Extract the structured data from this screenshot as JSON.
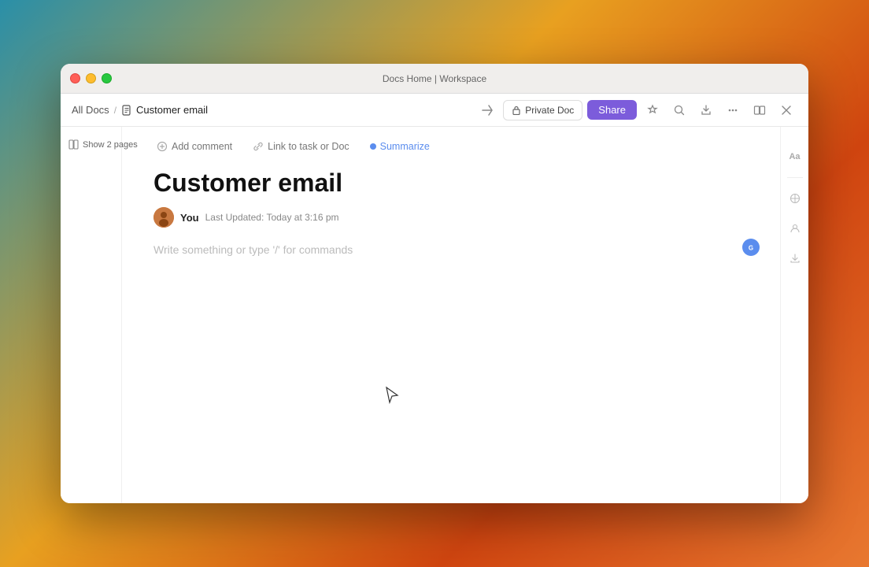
{
  "window": {
    "title": "Docs Home | Workspace"
  },
  "breadcrumb": {
    "all_docs_label": "All Docs",
    "separator": "/",
    "current_doc": "Customer email"
  },
  "toolbar": {
    "private_doc_label": "Private Doc",
    "share_label": "Share"
  },
  "sidebar_left": {
    "show_pages_label": "Show 2 pages"
  },
  "doc_actions": {
    "add_comment_label": "Add comment",
    "link_task_label": "Link to task or Doc",
    "summarize_label": "Summarize"
  },
  "document": {
    "title": "Customer email",
    "author": "You",
    "last_updated_prefix": "Last Updated: ",
    "last_updated_time": "Today at 3:16 pm",
    "editor_placeholder": "Write something or type '/' for commands"
  },
  "icons": {
    "close": "×",
    "minimize": "−",
    "maximize": "+",
    "star": "☆",
    "search": "⌕",
    "export": "↗",
    "more": "···",
    "collapse": "⊠",
    "fullscreen_exit": "⊡",
    "lock": "🔒",
    "comment": "💬",
    "link": "🔗",
    "pages": "⊞",
    "font": "Aa",
    "divider_v": "|",
    "chevron_down": "⌄",
    "download": "↓",
    "person_share": "👤"
  },
  "colors": {
    "share_btn_bg": "#7c5cdb",
    "share_btn_text": "#ffffff",
    "accent_blue": "#5b8dee",
    "cursor_indicator": "#5b8dee"
  }
}
